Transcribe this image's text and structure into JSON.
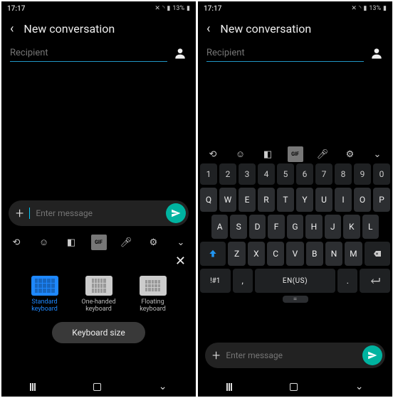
{
  "status": {
    "time": "17:17",
    "battery": "13%"
  },
  "header": {
    "title": "New conversation"
  },
  "recipient": {
    "placeholder": "Recipient"
  },
  "compose": {
    "placeholder": "Enter message"
  },
  "kb_types": {
    "close": "✕",
    "options": [
      {
        "label": "Standard keyboard",
        "selected": true
      },
      {
        "label": "One-handed keyboard",
        "selected": false
      },
      {
        "label": "Floating keyboard",
        "selected": false
      }
    ],
    "size_button": "Keyboard size"
  },
  "keyboard": {
    "toolbar_gif": "GIF",
    "row_num": [
      "1",
      "2",
      "3",
      "4",
      "5",
      "6",
      "7",
      "8",
      "9",
      "0"
    ],
    "row1": [
      "Q",
      "W",
      "E",
      "R",
      "T",
      "Y",
      "U",
      "I",
      "O",
      "P"
    ],
    "row2": [
      "A",
      "S",
      "D",
      "F",
      "G",
      "H",
      "J",
      "K",
      "L"
    ],
    "row3": [
      "Z",
      "X",
      "C",
      "V",
      "B",
      "N",
      "M"
    ],
    "sym": "!#1",
    "comma": ",",
    "space": "EN(US)",
    "period": ".",
    "handle": "="
  }
}
